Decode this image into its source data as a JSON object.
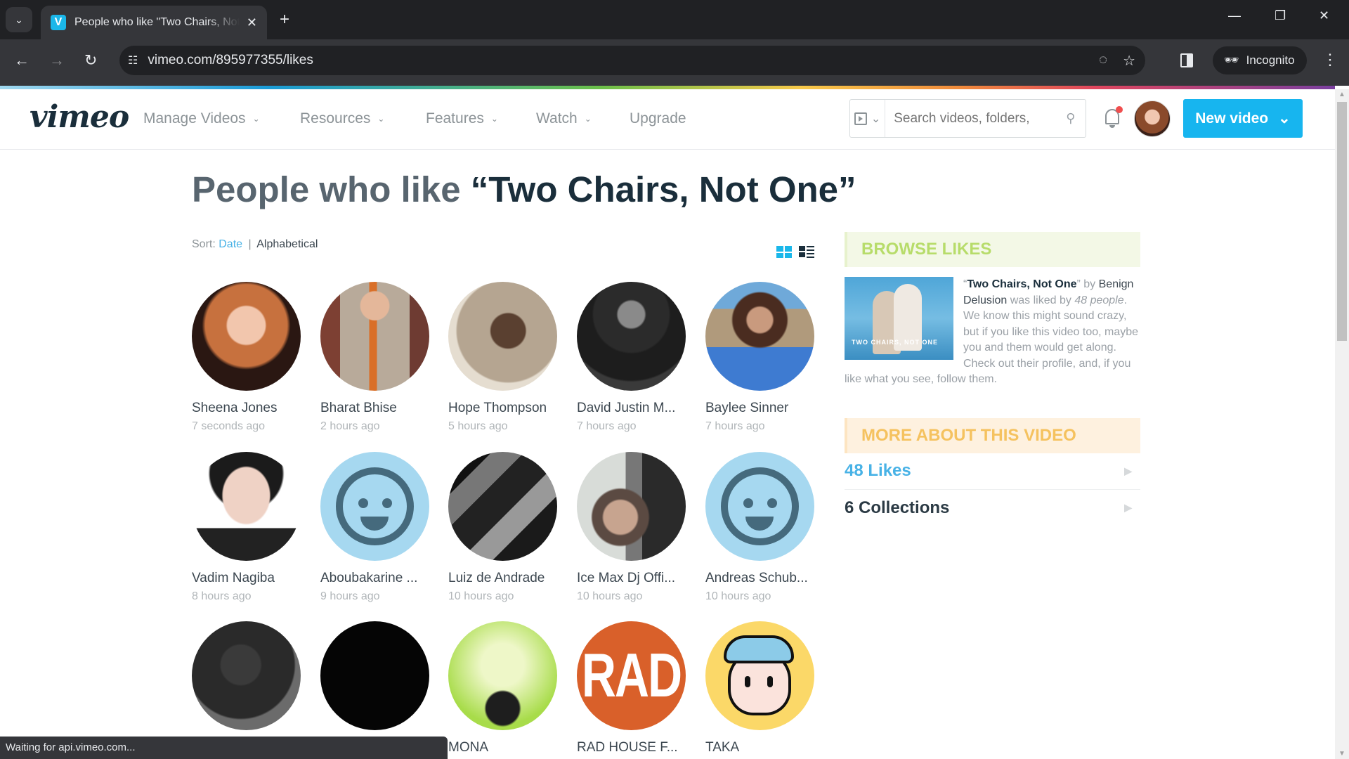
{
  "browser": {
    "tab_title": "People who like \"Two Chairs, Not One\"",
    "favicon": "V",
    "url": "vimeo.com/895977355/likes",
    "incognito_label": "Incognito",
    "status_text": "Waiting for api.vimeo.com..."
  },
  "header": {
    "logo": "vimeo",
    "menu": [
      {
        "label": "Manage Videos",
        "dropdown": true
      },
      {
        "label": "Resources",
        "dropdown": true
      },
      {
        "label": "Features",
        "dropdown": true
      },
      {
        "label": "Watch",
        "dropdown": true
      },
      {
        "label": "Upgrade",
        "dropdown": false
      }
    ],
    "search_placeholder": "Search videos, folders, and more",
    "search_display": "Search videos, folders,",
    "new_video_label": "New video",
    "brand_color": "#17b5ef",
    "notification_dot_color": "#f04e4e"
  },
  "main": {
    "title_prefix": "People who like ",
    "title_video": "“Two Chairs, Not One”",
    "sort": {
      "label": "Sort:",
      "options": [
        "Date",
        "Alphabetical"
      ],
      "active": "Date",
      "separator": "|"
    },
    "people": [
      {
        "name": "Sheena Jones",
        "time": "7 seconds ago",
        "avatar": "photo"
      },
      {
        "name": "Bharat Bhise",
        "time": "2 hours ago",
        "avatar": "photo"
      },
      {
        "name": "Hope Thompson",
        "time": "5 hours ago",
        "avatar": "photo"
      },
      {
        "name": "David Justin M...",
        "time": "7 hours ago",
        "avatar": "photo"
      },
      {
        "name": "Baylee Sinner",
        "time": "7 hours ago",
        "avatar": "photo"
      },
      {
        "name": "Vadim Nagiba",
        "time": "8 hours ago",
        "avatar": "photo"
      },
      {
        "name": "Aboubakarine ...",
        "time": "9 hours ago",
        "avatar": "default-smiley"
      },
      {
        "name": "Luiz de Andrade",
        "time": "10 hours ago",
        "avatar": "photo"
      },
      {
        "name": "Ice Max Dj Offi...",
        "time": "10 hours ago",
        "avatar": "photo"
      },
      {
        "name": "Andreas Schub...",
        "time": "10 hours ago",
        "avatar": "default-smiley"
      },
      {
        "name": "",
        "time": "",
        "avatar": "photo"
      },
      {
        "name": "",
        "time": "",
        "avatar": "photo"
      },
      {
        "name": "MONA",
        "time": "",
        "avatar": "photo"
      },
      {
        "name": "RAD HOUSE F...",
        "time": "",
        "avatar": "logo-rad"
      },
      {
        "name": "TAKA",
        "time": "",
        "avatar": "illustration"
      }
    ]
  },
  "sidebar": {
    "browse_heading": "BROWSE LIKES",
    "thumb_caption": "TWO CHAIRS, NOT ONE",
    "video_title": "Two Chairs, Not One",
    "by": "by",
    "author": "Benign Delusion",
    "liked_by": "was liked by",
    "count_text": "48 people",
    "blurb": ". We know this might sound crazy, but if you like this video too, maybe you and them would get along. Check out their profile, and, if you like what you see, follow them.",
    "more_heading": "MORE ABOUT THIS VIDEO",
    "links": [
      {
        "label": "48 Likes",
        "active": true
      },
      {
        "label": "6 Collections",
        "active": false
      }
    ]
  }
}
